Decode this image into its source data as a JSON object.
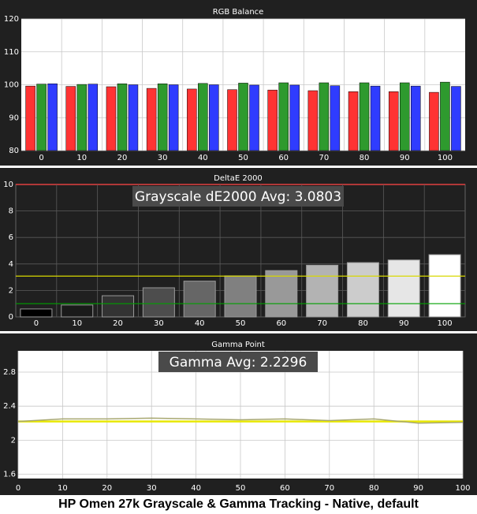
{
  "caption": "HP Omen 27k Grayscale & Gamma Tracking - Native, default",
  "colors": {
    "background": "#202020",
    "red": "#ff3333",
    "green": "#2e9a2e",
    "blue": "#2f3cff",
    "threshold_high": "#d8d800",
    "threshold_low": "#00a000",
    "max_line": "#e04040",
    "gamma_target": "#e8e800",
    "gamma_measured": "#a8a870"
  },
  "chart_data": [
    {
      "type": "bar",
      "title": "RGB Balance",
      "categories": [
        "0",
        "10",
        "20",
        "30",
        "40",
        "50",
        "60",
        "70",
        "80",
        "90",
        "100"
      ],
      "ylim": [
        80,
        120
      ],
      "yticks": [
        80,
        90,
        100,
        110,
        120
      ],
      "series": [
        {
          "color": "red",
          "values": [
            99.6,
            99.5,
            99.4,
            98.9,
            98.7,
            98.5,
            98.4,
            98.2,
            97.9,
            97.9,
            97.7
          ]
        },
        {
          "color": "green",
          "values": [
            100.2,
            100.1,
            100.3,
            100.3,
            100.4,
            100.5,
            100.6,
            100.6,
            100.6,
            100.6,
            100.8
          ]
        },
        {
          "color": "blue",
          "values": [
            100.3,
            100.2,
            100.0,
            100.0,
            100.0,
            99.9,
            99.9,
            99.7,
            99.6,
            99.6,
            99.5
          ]
        }
      ]
    },
    {
      "type": "bar",
      "title": "DeltaE 2000",
      "annotation": "Grayscale dE2000 Avg: 3.0803",
      "categories": [
        "0",
        "10",
        "20",
        "30",
        "40",
        "50",
        "60",
        "70",
        "80",
        "90",
        "100"
      ],
      "ylim": [
        0,
        10
      ],
      "yticks": [
        0,
        2,
        4,
        6,
        8,
        10
      ],
      "values": [
        0.6,
        0.9,
        1.6,
        2.2,
        2.7,
        3.1,
        3.5,
        3.9,
        4.1,
        4.3,
        4.7
      ],
      "bar_shades": [
        "#000000",
        "#1a1a1a",
        "#333333",
        "#4d4d4d",
        "#666666",
        "#808080",
        "#999999",
        "#b3b3b3",
        "#cccccc",
        "#e6e6e6",
        "#ffffff"
      ],
      "reference_lines": [
        3.08,
        1.0
      ]
    },
    {
      "type": "line",
      "title": "Gamma Point",
      "annotation": "Gamma Avg: 2.2296",
      "x": [
        0,
        10,
        20,
        30,
        40,
        50,
        60,
        70,
        80,
        90,
        100
      ],
      "xlim": [
        0,
        100
      ],
      "ylim": [
        1.55,
        3.05
      ],
      "yticks": [
        1.6,
        2,
        2.4,
        2.8
      ],
      "xticks": [
        0,
        10,
        20,
        30,
        40,
        50,
        60,
        70,
        80,
        90,
        100
      ],
      "target": 2.22,
      "series": [
        {
          "values": [
            2.22,
            2.25,
            2.25,
            2.26,
            2.25,
            2.24,
            2.25,
            2.23,
            2.25,
            2.2,
            2.21
          ]
        }
      ]
    }
  ]
}
